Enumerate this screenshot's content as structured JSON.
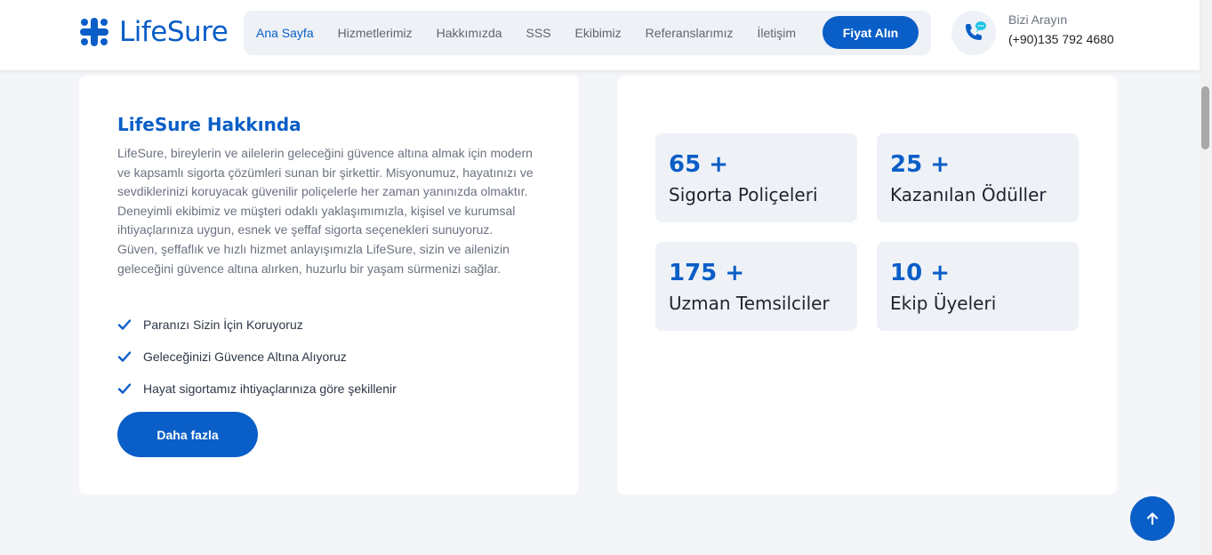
{
  "brand": {
    "name": "LifeSure",
    "color": "#0a5ec7",
    "logo_icon": "cross-dots-icon"
  },
  "nav": {
    "items": [
      {
        "label": "Ana Sayfa",
        "active": true
      },
      {
        "label": "Hizmetlerimiz",
        "active": false
      },
      {
        "label": "Hakkımızda",
        "active": false
      },
      {
        "label": "SSS",
        "active": false
      },
      {
        "label": "Ekibimiz",
        "active": false
      },
      {
        "label": "Referanslarımız",
        "active": false
      },
      {
        "label": "İletişim",
        "active": false
      }
    ],
    "cta_label": "Fiyat Alın"
  },
  "contact": {
    "label": "Bizi Arayın",
    "phone": "(+90)135 792 4680",
    "icon": "phone-chat-icon"
  },
  "about": {
    "title": "LifeSure Hakkında",
    "text": "LifeSure, bireylerin ve ailelerin geleceğini güvence altına almak için modern ve kapsamlı sigorta çözümleri sunan bir şirkettir. Misyonumuz, hayatınızı ve sevdiklerinizi koruyacak güvenilir poliçelerle her zaman yanınızda olmaktır. Deneyimli ekibimiz ve müşteri odaklı yaklaşımımızla, kişisel ve kurumsal ihtiyaçlarınıza uygun, esnek ve şeffaf sigorta seçenekleri sunuyoruz. Güven, şeffaflık ve hızlı hizmet anlayışımızla LifeSure, sizin ve ailenizin geleceğini güvence altına alırken, huzurlu bir yaşam sürmenizi sağlar.",
    "checks": [
      "Paranızı Sizin İçin Koruyoruz",
      "Geleceğinizi Güvence Altına Alıyoruz",
      "Hayat sigortamız ihtiyaçlarınıza göre şekillenir"
    ],
    "button_label": "Daha fazla"
  },
  "stats": [
    {
      "number": "65 +",
      "label": "Sigorta Poliçeleri"
    },
    {
      "number": "25 +",
      "label": "Kazanılan Ödüller"
    },
    {
      "number": "175 +",
      "label": "Uzman Temsilciler"
    },
    {
      "number": "10 +",
      "label": "Ekip Üyeleri"
    }
  ],
  "back_to_top_icon": "arrow-up-icon"
}
